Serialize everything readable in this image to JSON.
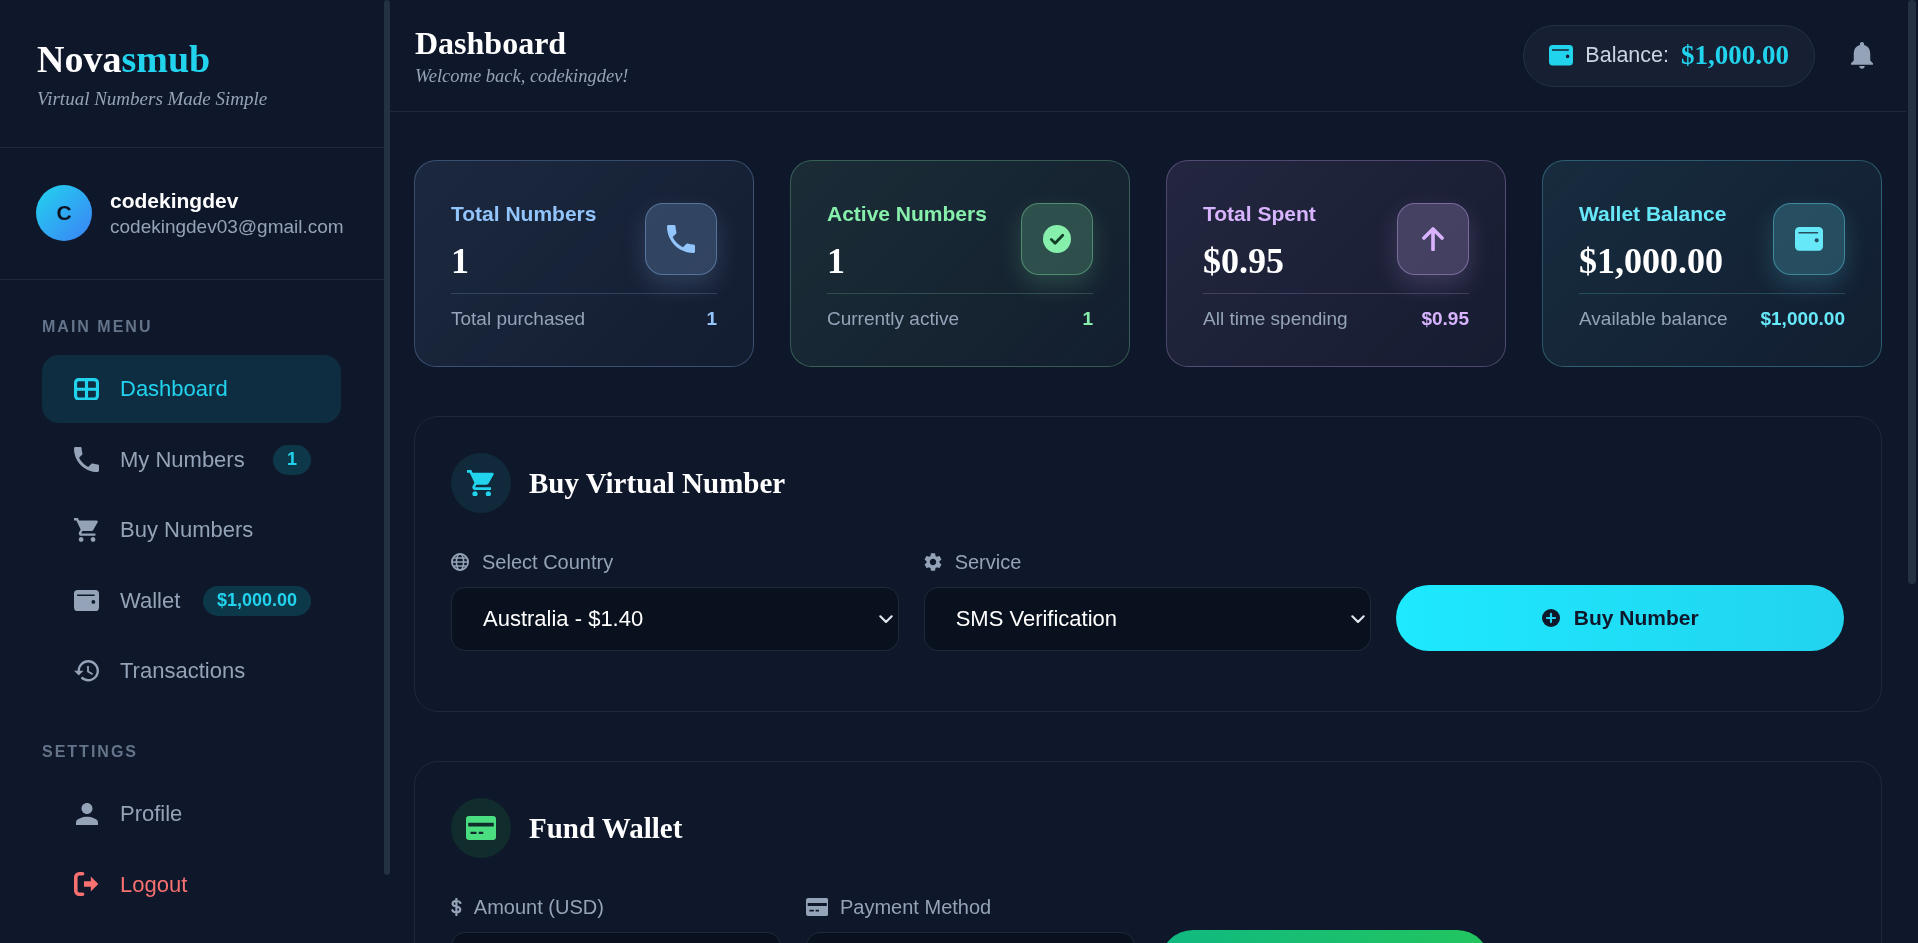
{
  "sidebar": {
    "logo": {
      "text": "Nova",
      "accent": "smub"
    },
    "tagline": "Virtual Numbers Made Simple",
    "user": {
      "initial": "C",
      "name": "codekingdev",
      "email": "codekingdev03@gmail.com"
    },
    "sections": [
      {
        "heading": "MAIN MENU",
        "items": [
          {
            "label": "Dashboard",
            "selected": true
          },
          {
            "label": "My Numbers",
            "selected": false,
            "badge": "1"
          },
          {
            "label": "Buy Numbers",
            "selected": false
          },
          {
            "label": "Wallet",
            "selected": false,
            "badge": "$1,000.00"
          },
          {
            "label": "Transactions",
            "selected": false
          }
        ]
      },
      {
        "heading": "SETTINGS",
        "items": [
          {
            "label": "Profile",
            "selected": false,
            "color": "#94a3b8"
          },
          {
            "label": "Logout",
            "selected": false,
            "color": "#f87171"
          }
        ]
      }
    ]
  },
  "header": {
    "title": "Dashboard",
    "subtitle": "Welcome back, codekingdev!",
    "balance": {
      "label": "Balance:",
      "value": "$1,000.00"
    }
  },
  "stats": [
    {
      "title": "Total Numbers",
      "value": "1",
      "caption": "Total purchased",
      "caption_value": "1",
      "color": "#93c5fd"
    },
    {
      "title": "Active Numbers",
      "value": "1",
      "caption": "Currently active",
      "caption_value": "1",
      "color": "#86efac"
    },
    {
      "title": "Total Spent",
      "value": "$0.95",
      "caption": "All time spending",
      "caption_value": "$0.95",
      "color": "#d8b4fe"
    },
    {
      "title": "Wallet Balance",
      "value": "$1,000.00",
      "caption": "Available balance",
      "caption_value": "$1,000.00",
      "color": "#67e8f9"
    }
  ],
  "buy_panel": {
    "title": "Buy Virtual Number",
    "fields": [
      {
        "label": "Select Country",
        "value": "Australia - $1.40"
      },
      {
        "label": "Service",
        "value": "SMS Verification"
      }
    ],
    "button": "Buy Number"
  },
  "fund_panel": {
    "title": "Fund Wallet",
    "fields": [
      {
        "label": "Amount (USD)"
      },
      {
        "label": "Payment Method"
      }
    ]
  }
}
